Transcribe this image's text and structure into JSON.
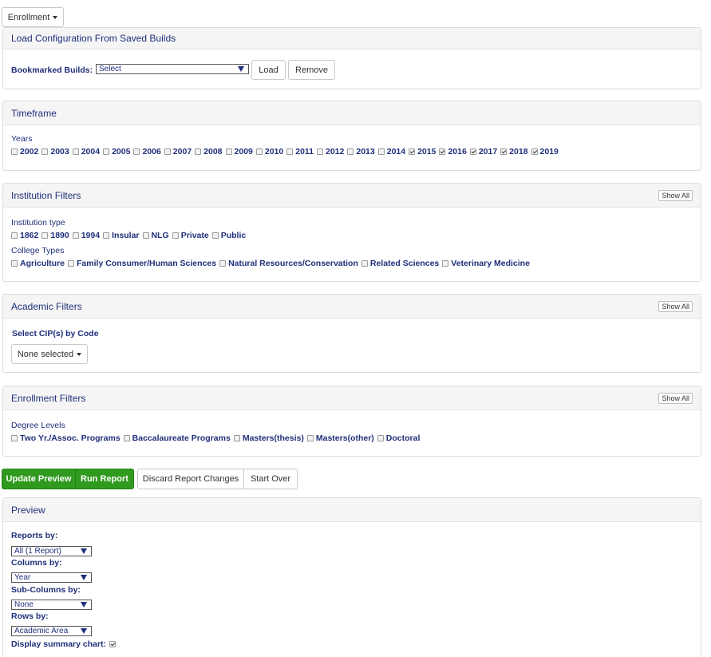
{
  "top_dropdown": {
    "label": "Enrollment"
  },
  "saved_builds": {
    "title": "Load Configuration From Saved Builds",
    "bookmark_label": "Bookmarked Builds:",
    "select_value": "Select",
    "load_label": "Load",
    "remove_label": "Remove"
  },
  "timeframe": {
    "title": "Timeframe",
    "years_label": "Years",
    "years": [
      {
        "label": "2002",
        "checked": false
      },
      {
        "label": "2003",
        "checked": false
      },
      {
        "label": "2004",
        "checked": false
      },
      {
        "label": "2005",
        "checked": false
      },
      {
        "label": "2006",
        "checked": false
      },
      {
        "label": "2007",
        "checked": false
      },
      {
        "label": "2008",
        "checked": false
      },
      {
        "label": "2009",
        "checked": false
      },
      {
        "label": "2010",
        "checked": false
      },
      {
        "label": "2011",
        "checked": false
      },
      {
        "label": "2012",
        "checked": false
      },
      {
        "label": "2013",
        "checked": false
      },
      {
        "label": "2014",
        "checked": false
      },
      {
        "label": "2015",
        "checked": true
      },
      {
        "label": "2016",
        "checked": true
      },
      {
        "label": "2017",
        "checked": true
      },
      {
        "label": "2018",
        "checked": true
      },
      {
        "label": "2019",
        "checked": true
      }
    ]
  },
  "institution": {
    "title": "Institution Filters",
    "show_all": "Show All",
    "type_label": "Institution type",
    "types": [
      {
        "label": "1862",
        "checked": false
      },
      {
        "label": "1890",
        "checked": false
      },
      {
        "label": "1994",
        "checked": false
      },
      {
        "label": "Insular",
        "checked": false
      },
      {
        "label": "NLG",
        "checked": false
      },
      {
        "label": "Private",
        "checked": false
      },
      {
        "label": "Public",
        "checked": false
      }
    ],
    "college_label": "College Types",
    "colleges": [
      {
        "label": "Agriculture",
        "checked": false
      },
      {
        "label": "Family Consumer/Human Sciences",
        "checked": false
      },
      {
        "label": "Natural Resources/Conservation",
        "checked": false
      },
      {
        "label": "Related Sciences",
        "checked": false
      },
      {
        "label": "Veterinary Medicine",
        "checked": false
      }
    ]
  },
  "academic": {
    "title": "Academic Filters",
    "show_all": "Show All",
    "cip_label": "Select CIP(s) by Code",
    "cip_value": "None selected"
  },
  "enrollment": {
    "title": "Enrollment Filters",
    "show_all": "Show All",
    "degree_label": "Degree Levels",
    "degrees": [
      {
        "label": "Two Yr./Assoc. Programs",
        "checked": false
      },
      {
        "label": "Baccalaureate Programs",
        "checked": false
      },
      {
        "label": "Masters(thesis)",
        "checked": false
      },
      {
        "label": "Masters(other)",
        "checked": false
      },
      {
        "label": "Doctoral",
        "checked": false
      }
    ]
  },
  "actions": {
    "update_preview": "Update Preview",
    "run_report": "Run Report",
    "discard": "Discard Report Changes",
    "start_over": "Start Over"
  },
  "preview": {
    "title": "Preview",
    "reports_by_label": "Reports by:",
    "reports_by_value": "All (1 Report)",
    "columns_by_label": "Columns by:",
    "columns_by_value": "Year",
    "subcolumns_by_label": "Sub-Columns by:",
    "subcolumns_by_value": "None",
    "rows_by_label": "Rows by:",
    "rows_by_value": "Academic Area",
    "summary_chart_label": "Display summary chart:",
    "summary_chart_checked": true
  },
  "colors": {
    "accent": "#1f2f7a",
    "green": "#2f9a1e"
  }
}
